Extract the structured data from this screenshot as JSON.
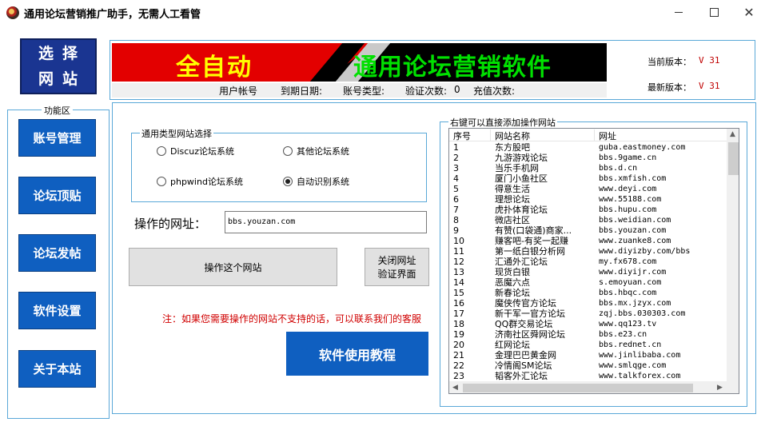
{
  "window": {
    "title": "通用论坛营销推广助手，无需人工看管",
    "minimize": "—",
    "maximize": "☐",
    "close": "✕"
  },
  "select_site": {
    "line1": "选择",
    "line2": "网站"
  },
  "sidebar": {
    "legend": "功能区",
    "items": [
      {
        "label": "账号管理"
      },
      {
        "label": "论坛顶贴"
      },
      {
        "label": "论坛发帖"
      },
      {
        "label": "软件设置"
      },
      {
        "label": "关于本站"
      }
    ]
  },
  "banner": {
    "left_text": "全自动",
    "right_text": "通用论坛营销软件"
  },
  "account_info": {
    "user_label": "用户帐号",
    "expire_label": "到期日期:",
    "type_label": "账号类型:",
    "verify_label": "验证次数:",
    "verify_value": "0",
    "recharge_label": "充值次数:"
  },
  "version": {
    "current_label": "当前版本：",
    "current_value": "V 31",
    "latest_label": "最新版本：",
    "latest_value": "V 31"
  },
  "site_type": {
    "legend": "通用类型网站选择",
    "options": [
      {
        "label": "Discuz论坛系统",
        "checked": false
      },
      {
        "label": "其他论坛系统",
        "checked": false
      },
      {
        "label": "phpwind论坛系统",
        "checked": false
      },
      {
        "label": "自动识别系统",
        "checked": true
      }
    ]
  },
  "url": {
    "label": "操作的网址：",
    "value": "bbs.youzan.com"
  },
  "buttons": {
    "operate": "操作这个网站",
    "close_verify_line1": "关闭网址",
    "close_verify_line2": "验证界面",
    "tutorial": "软件使用教程"
  },
  "note": "注：如果您需要操作的网站不支持的话，可以联系我们的客服",
  "site_list": {
    "legend": "右键可以直接添加操作网站",
    "columns": [
      "序号",
      "网站名称",
      "网址"
    ],
    "rows": [
      [
        "1",
        "东方股吧",
        "guba.eastmoney.com"
      ],
      [
        "2",
        "九游游戏论坛",
        "bbs.9game.cn"
      ],
      [
        "3",
        "当乐手机网",
        "bbs.d.cn"
      ],
      [
        "4",
        "厦门小鱼社区",
        "bbs.xmfish.com"
      ],
      [
        "5",
        "得意生活",
        "www.deyi.com"
      ],
      [
        "6",
        "理想论坛",
        "www.55188.com"
      ],
      [
        "7",
        "虎扑体育论坛",
        "bbs.hupu.com"
      ],
      [
        "8",
        "微店社区",
        "bbs.weidian.com"
      ],
      [
        "9",
        "有赞(口袋通)商家...",
        "bbs.youzan.com"
      ],
      [
        "10",
        "赚客吧-有奖一起赚",
        "www.zuanke8.com"
      ],
      [
        "11",
        "第一纸白银分析网",
        "www.diyizby.com/bbs"
      ],
      [
        "12",
        "汇通外汇论坛",
        "my.fx678.com"
      ],
      [
        "13",
        "现货白银",
        "www.diyijr.com"
      ],
      [
        "14",
        "恶魔六点",
        "s.emoyuan.com"
      ],
      [
        "15",
        "新春论坛",
        "bbs.hbqc.com"
      ],
      [
        "16",
        "魔侠传官方论坛",
        "bbs.mx.jzyx.com"
      ],
      [
        "17",
        "新干军一官方论坛",
        "zqj.bbs.030303.com"
      ],
      [
        "18",
        "QQ群交易论坛",
        "www.qq123.tv"
      ],
      [
        "19",
        "济南社区舜网论坛",
        "bbs.e23.cn"
      ],
      [
        "20",
        "红网论坛",
        "bbs.rednet.cn"
      ],
      [
        "21",
        "金理巴巴黄金网",
        "www.jinlibaba.com"
      ],
      [
        "22",
        "冷情阁SM论坛",
        "www.smlqge.com"
      ],
      [
        "23",
        "韬客外汇论坛",
        "www.talkforex.com"
      ]
    ]
  },
  "colors": {
    "accent_blue": "#0f5fc0",
    "dark_blue": "#1a3591",
    "banner_red": "#e30000",
    "banner_yellow": "#ffff00",
    "banner_green": "#00e000",
    "note_red": "#d00000",
    "frame_blue": "#5aa8d8"
  }
}
